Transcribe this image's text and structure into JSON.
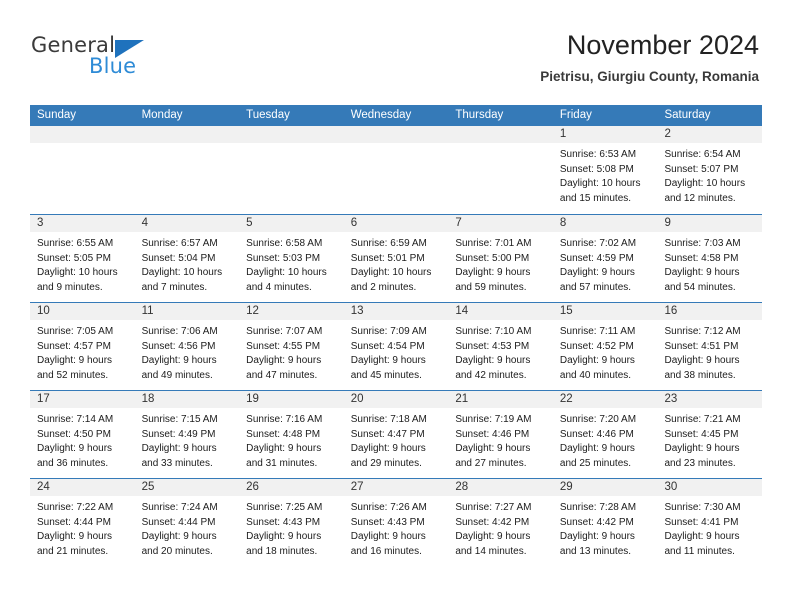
{
  "logo": {
    "word1": "General",
    "word2": "Blue",
    "triangle_color": "#1f72bd",
    "blue_color": "#2e8bd6"
  },
  "header": {
    "title": "November 2024",
    "subtitle": "Pietrisu, Giurgiu County, Romania"
  },
  "theme": {
    "header_blue": "#357ab8",
    "day_band_gray": "#f1f1f1",
    "text": "#1c1c1c"
  },
  "calendar": {
    "weekdays": [
      "Sunday",
      "Monday",
      "Tuesday",
      "Wednesday",
      "Thursday",
      "Friday",
      "Saturday"
    ],
    "labels": {
      "sunrise": "Sunrise:",
      "sunset": "Sunset:",
      "daylight": "Daylight:"
    },
    "weeks": [
      [
        {
          "day": "",
          "empty": true
        },
        {
          "day": "",
          "empty": true
        },
        {
          "day": "",
          "empty": true
        },
        {
          "day": "",
          "empty": true
        },
        {
          "day": "",
          "empty": true
        },
        {
          "day": "1",
          "sunrise": "Sunrise: 6:53 AM",
          "sunset": "Sunset: 5:08 PM",
          "daylight": "Daylight: 10 hours and 15 minutes."
        },
        {
          "day": "2",
          "sunrise": "Sunrise: 6:54 AM",
          "sunset": "Sunset: 5:07 PM",
          "daylight": "Daylight: 10 hours and 12 minutes."
        }
      ],
      [
        {
          "day": "3",
          "sunrise": "Sunrise: 6:55 AM",
          "sunset": "Sunset: 5:05 PM",
          "daylight": "Daylight: 10 hours and 9 minutes."
        },
        {
          "day": "4",
          "sunrise": "Sunrise: 6:57 AM",
          "sunset": "Sunset: 5:04 PM",
          "daylight": "Daylight: 10 hours and 7 minutes."
        },
        {
          "day": "5",
          "sunrise": "Sunrise: 6:58 AM",
          "sunset": "Sunset: 5:03 PM",
          "daylight": "Daylight: 10 hours and 4 minutes."
        },
        {
          "day": "6",
          "sunrise": "Sunrise: 6:59 AM",
          "sunset": "Sunset: 5:01 PM",
          "daylight": "Daylight: 10 hours and 2 minutes."
        },
        {
          "day": "7",
          "sunrise": "Sunrise: 7:01 AM",
          "sunset": "Sunset: 5:00 PM",
          "daylight": "Daylight: 9 hours and 59 minutes."
        },
        {
          "day": "8",
          "sunrise": "Sunrise: 7:02 AM",
          "sunset": "Sunset: 4:59 PM",
          "daylight": "Daylight: 9 hours and 57 minutes."
        },
        {
          "day": "9",
          "sunrise": "Sunrise: 7:03 AM",
          "sunset": "Sunset: 4:58 PM",
          "daylight": "Daylight: 9 hours and 54 minutes."
        }
      ],
      [
        {
          "day": "10",
          "sunrise": "Sunrise: 7:05 AM",
          "sunset": "Sunset: 4:57 PM",
          "daylight": "Daylight: 9 hours and 52 minutes."
        },
        {
          "day": "11",
          "sunrise": "Sunrise: 7:06 AM",
          "sunset": "Sunset: 4:56 PM",
          "daylight": "Daylight: 9 hours and 49 minutes."
        },
        {
          "day": "12",
          "sunrise": "Sunrise: 7:07 AM",
          "sunset": "Sunset: 4:55 PM",
          "daylight": "Daylight: 9 hours and 47 minutes."
        },
        {
          "day": "13",
          "sunrise": "Sunrise: 7:09 AM",
          "sunset": "Sunset: 4:54 PM",
          "daylight": "Daylight: 9 hours and 45 minutes."
        },
        {
          "day": "14",
          "sunrise": "Sunrise: 7:10 AM",
          "sunset": "Sunset: 4:53 PM",
          "daylight": "Daylight: 9 hours and 42 minutes."
        },
        {
          "day": "15",
          "sunrise": "Sunrise: 7:11 AM",
          "sunset": "Sunset: 4:52 PM",
          "daylight": "Daylight: 9 hours and 40 minutes."
        },
        {
          "day": "16",
          "sunrise": "Sunrise: 7:12 AM",
          "sunset": "Sunset: 4:51 PM",
          "daylight": "Daylight: 9 hours and 38 minutes."
        }
      ],
      [
        {
          "day": "17",
          "sunrise": "Sunrise: 7:14 AM",
          "sunset": "Sunset: 4:50 PM",
          "daylight": "Daylight: 9 hours and 36 minutes."
        },
        {
          "day": "18",
          "sunrise": "Sunrise: 7:15 AM",
          "sunset": "Sunset: 4:49 PM",
          "daylight": "Daylight: 9 hours and 33 minutes."
        },
        {
          "day": "19",
          "sunrise": "Sunrise: 7:16 AM",
          "sunset": "Sunset: 4:48 PM",
          "daylight": "Daylight: 9 hours and 31 minutes."
        },
        {
          "day": "20",
          "sunrise": "Sunrise: 7:18 AM",
          "sunset": "Sunset: 4:47 PM",
          "daylight": "Daylight: 9 hours and 29 minutes."
        },
        {
          "day": "21",
          "sunrise": "Sunrise: 7:19 AM",
          "sunset": "Sunset: 4:46 PM",
          "daylight": "Daylight: 9 hours and 27 minutes."
        },
        {
          "day": "22",
          "sunrise": "Sunrise: 7:20 AM",
          "sunset": "Sunset: 4:46 PM",
          "daylight": "Daylight: 9 hours and 25 minutes."
        },
        {
          "day": "23",
          "sunrise": "Sunrise: 7:21 AM",
          "sunset": "Sunset: 4:45 PM",
          "daylight": "Daylight: 9 hours and 23 minutes."
        }
      ],
      [
        {
          "day": "24",
          "sunrise": "Sunrise: 7:22 AM",
          "sunset": "Sunset: 4:44 PM",
          "daylight": "Daylight: 9 hours and 21 minutes."
        },
        {
          "day": "25",
          "sunrise": "Sunrise: 7:24 AM",
          "sunset": "Sunset: 4:44 PM",
          "daylight": "Daylight: 9 hours and 20 minutes."
        },
        {
          "day": "26",
          "sunrise": "Sunrise: 7:25 AM",
          "sunset": "Sunset: 4:43 PM",
          "daylight": "Daylight: 9 hours and 18 minutes."
        },
        {
          "day": "27",
          "sunrise": "Sunrise: 7:26 AM",
          "sunset": "Sunset: 4:43 PM",
          "daylight": "Daylight: 9 hours and 16 minutes."
        },
        {
          "day": "28",
          "sunrise": "Sunrise: 7:27 AM",
          "sunset": "Sunset: 4:42 PM",
          "daylight": "Daylight: 9 hours and 14 minutes."
        },
        {
          "day": "29",
          "sunrise": "Sunrise: 7:28 AM",
          "sunset": "Sunset: 4:42 PM",
          "daylight": "Daylight: 9 hours and 13 minutes."
        },
        {
          "day": "30",
          "sunrise": "Sunrise: 7:30 AM",
          "sunset": "Sunset: 4:41 PM",
          "daylight": "Daylight: 9 hours and 11 minutes."
        }
      ]
    ]
  }
}
